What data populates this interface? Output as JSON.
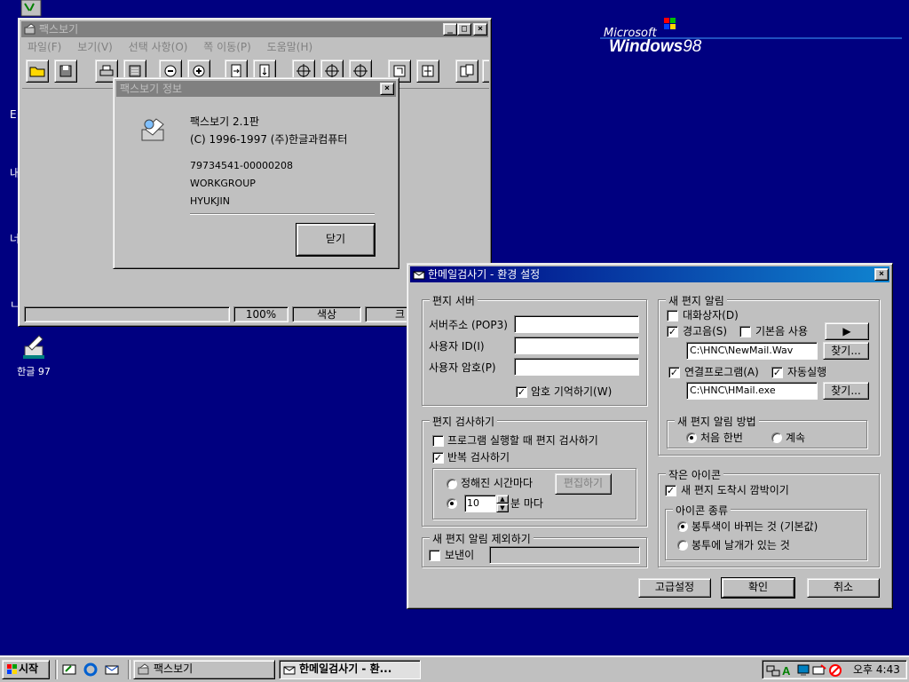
{
  "desktop": {
    "brand": {
      "ms": "Microsoft",
      "win": "Windows",
      "ver": "98"
    },
    "icons": [
      {
        "label": "한글 97"
      }
    ],
    "edge_chars": [
      "E",
      "내",
      "너",
      "ㄴ"
    ]
  },
  "fax": {
    "title": "팩스보기",
    "menu": [
      "파일(F)",
      "보기(V)",
      "선택 사항(O)",
      "쪽 이동(P)",
      "도움말(H)"
    ],
    "status": {
      "zoom": "100%",
      "mode": "색상",
      "extra": "크"
    }
  },
  "about": {
    "title": "팩스보기 정보",
    "product": "팩스보기 2.1판",
    "copyright": "(C) 1996-1997 (주)한글과컴퓨터",
    "serial": "79734541-00000208",
    "org": "WORKGROUP",
    "user": "HYUKJIN",
    "close_label": "닫기"
  },
  "settings": {
    "title": "한메일검사기 - 환경 설정",
    "server": {
      "legend": "편지 서버",
      "addr_label": "서버주소 (POP3)",
      "addr_value": "",
      "id_label": "사용자 ID(I)",
      "id_value": "",
      "pw_label": "사용자 암호(P)",
      "pw_value": "",
      "remember_label": "암호 기억하기(W)"
    },
    "check": {
      "legend": "편지 검사하기",
      "on_start_label": "프로그램 실행할 때 편지 검사하기",
      "repeat_label": "반복 검사하기",
      "fixed_label": "정해진 시간마다",
      "edit_label": "편집하기",
      "interval_value": "10",
      "interval_unit": "분 마다"
    },
    "exclude": {
      "legend": "새 편지 알림 제외하기",
      "sender_label": "보낸이",
      "sender_value": ""
    },
    "notify": {
      "legend": "새 편지 알림",
      "dialog_label": "대화상자(D)",
      "sound_label": "경고음(S)",
      "default_sound_label": "기본음 사용",
      "play_glyph": "▶",
      "sound_file": "C:\\HNC\\NewMail.Wav",
      "browse_label": "찾기...",
      "linked_label": "연결프로그램(A)",
      "autorun_label": "자동실행",
      "program_file": "C:\\HNC\\HMail.exe"
    },
    "method": {
      "legend": "새 편지 알림 방법",
      "once_label": "처음 한번",
      "continuous_label": "계속"
    },
    "small_icon": {
      "legend": "작은 아이콘",
      "blink_label": "새 편지 도착시 깜박이기",
      "type_legend": "아이콘 종류",
      "color_label": "봉투색이 바뀌는 것 (기본값)",
      "wing_label": "봉투에 날개가 있는 것"
    },
    "buttons": {
      "advanced": "고급설정",
      "ok": "확인",
      "cancel": "취소"
    }
  },
  "taskbar": {
    "start": "시작",
    "tasks": [
      "팩스보기",
      "한메일검사기 - 환..."
    ],
    "clock": "오후 4:43"
  }
}
